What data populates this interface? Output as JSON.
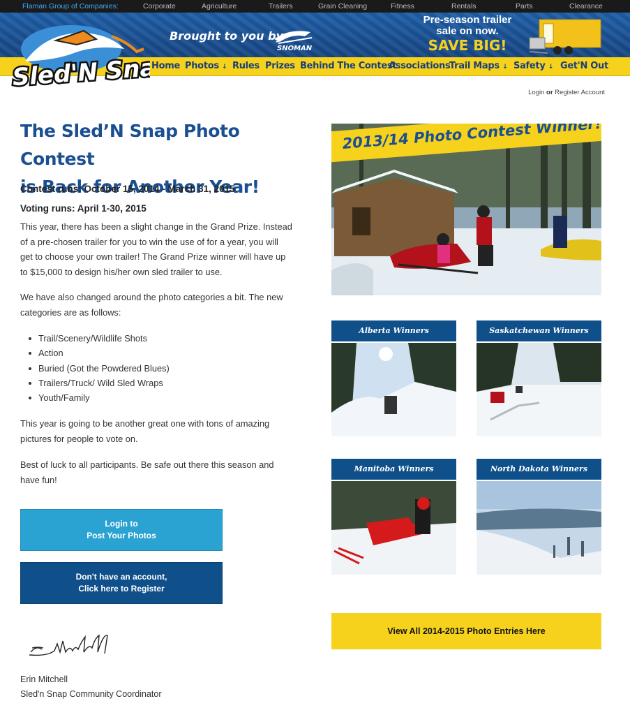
{
  "topbar": {
    "group_label": "Flaman Group of Companies:",
    "links": [
      "Corporate",
      "Agriculture",
      "Trailers",
      "Grain Cleaning",
      "Fitness",
      "Rentals",
      "Parts",
      "Clearance"
    ]
  },
  "banner": {
    "logo_text": "Sled'N Snap",
    "brought_by": "Brought to you by",
    "sponsor": "SNOMAN",
    "promo_line1": "Pre-season trailer",
    "promo_line2": "sale on now.",
    "promo_big": "SAVE BIG!"
  },
  "nav": [
    "Home",
    "Photos",
    "Rules",
    "Prizes",
    "Behind The Contest",
    "Associations",
    "Trail Maps",
    "Safety",
    "Get'N Out"
  ],
  "account": {
    "login": "Login",
    "or": "or",
    "register": "Register Account"
  },
  "main": {
    "title_line1": "The Sled’N Snap Photo Contest",
    "title_line2": "is Back for Another Year!",
    "contest_runs": "Contest runs: October 15, 2014 - March 31, 2015",
    "voting_runs": "Voting runs: April 1-30, 2015",
    "p1_l1": "This year, there has been a slight change in the Grand Prize. Instead",
    "p1_l2": "of a pre-chosen trailer for you to win the use of for a year, you will",
    "p1_l3": "get to choose your own trailer! The Grand Prize winner will have up",
    "p1_l4": "to $15,000 to design his/her own sled trailer to use.",
    "p2_l1": "We have also changed around the photo categories a bit. The new",
    "p2_l2": "categories are as follows:",
    "categories": [
      "Trail/Scenery/Wildlife Shots",
      "Action",
      "Buried (Got the Powdered Blues)",
      "Trailers/Truck/ Wild Sled Wraps",
      "Youth/Family"
    ],
    "p3_l1": "This year is going to be another great one with tons of amazing",
    "p3_l2": "pictures for people to vote on.",
    "p4_l1": "Best of luck to all participants. Be safe out there this season and",
    "p4_l2": "have fun!",
    "btn_login_l1": "Login to",
    "btn_login_l2": "Post Your Photos",
    "btn_register_l1": "Don't have an account,",
    "btn_register_l2": "Click here to Register",
    "signer_name": "Erin Mitchell",
    "signer_title": "Sled'n Snap Community Coordinator"
  },
  "sidebar": {
    "hero_caption": "2013/14 Photo Contest Winner!",
    "cards": [
      "Alberta Winners",
      "Saskatchewan Winners",
      "Manitoba Winners",
      "North Dakota Winners"
    ],
    "view_all": "View All 2014-2015 Photo Entries Here"
  },
  "colors": {
    "brand_blue": "#1a4f91",
    "brand_yellow": "#f6d21d",
    "button_cyan": "#2aa3d2",
    "button_navy": "#0f4f8a"
  }
}
